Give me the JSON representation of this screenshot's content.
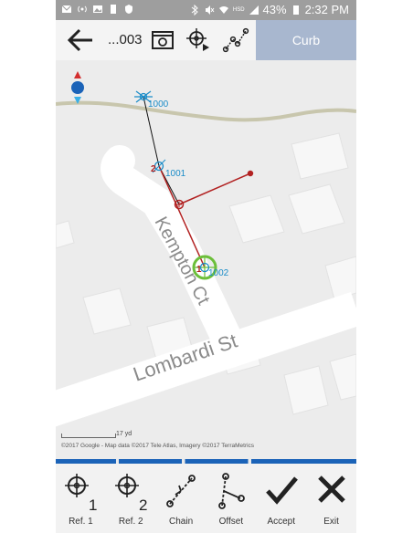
{
  "status_bar": {
    "battery_percent": "43%",
    "time": "2:32 PM",
    "network_label": "HSD"
  },
  "toolbar": {
    "file_label": "...003",
    "curb_label": "Curb"
  },
  "map": {
    "points": [
      {
        "id": "1000"
      },
      {
        "id": "1001",
        "index": "2"
      },
      {
        "id": "1002",
        "index": "1"
      }
    ],
    "street_labels": [
      "Kempton Ct",
      "Lombardi St"
    ],
    "scale_label": "17 yd",
    "attribution": "©2017 Google - Map data ©2017 Tele Atlas, Imagery ©2017 TerraMetrics"
  },
  "bottom_bar": {
    "items": [
      {
        "label": "Ref. 1",
        "icon": "reference-1-icon"
      },
      {
        "label": "Ref. 2",
        "icon": "reference-2-icon"
      },
      {
        "label": "Chain",
        "icon": "chain-icon"
      },
      {
        "label": "Offset",
        "icon": "offset-icon"
      },
      {
        "label": "Accept",
        "icon": "checkmark-icon"
      },
      {
        "label": "Exit",
        "icon": "close-icon"
      }
    ]
  },
  "colors": {
    "accent": "#1b63b8",
    "line_red": "#b22222",
    "point_blue": "#1a8cc8",
    "target_green": "#6cbf3a",
    "curb_panel": "#a8b7cf"
  }
}
